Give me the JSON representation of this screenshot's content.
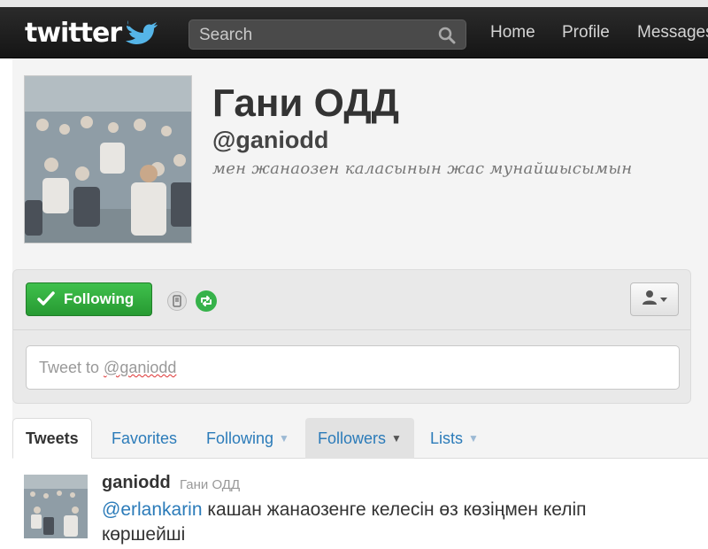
{
  "topbar": {
    "logo": "twitter",
    "search_placeholder": "Search",
    "nav": {
      "home": "Home",
      "profile": "Profile",
      "messages": "Messages"
    }
  },
  "profile": {
    "name": "Гани ОДД",
    "handle": "@ganiodd",
    "bio": "мен жанаозен каласынын жас мунайшысымын"
  },
  "actions": {
    "following_label": "Following",
    "tweet_to_placeholder_prefix": "Tweet to ",
    "tweet_to_placeholder_handle": "@ganiodd"
  },
  "tabs": [
    {
      "label": "Tweets",
      "active": true
    },
    {
      "label": "Favorites"
    },
    {
      "label": "Following",
      "caret": "▼"
    },
    {
      "label": "Followers",
      "caret": "▼"
    },
    {
      "label": "Lists",
      "caret": "▼"
    }
  ],
  "tweet": {
    "username": "ganiodd",
    "fullname": "Гани ОДД",
    "mention": "@erlankarin",
    "text": " кашан жанаозенге келесін өз көзіңмен келіп көршейші"
  },
  "colors": {
    "brand_bar": "#1c1c1c",
    "following_green": "#2fa83c",
    "link_blue": "#2b7bb9"
  },
  "icons": [
    "twitter-bird-icon",
    "search-icon",
    "checkmark-icon",
    "device-icon",
    "retweet-icon",
    "person-icon",
    "caret-down-icon"
  ]
}
